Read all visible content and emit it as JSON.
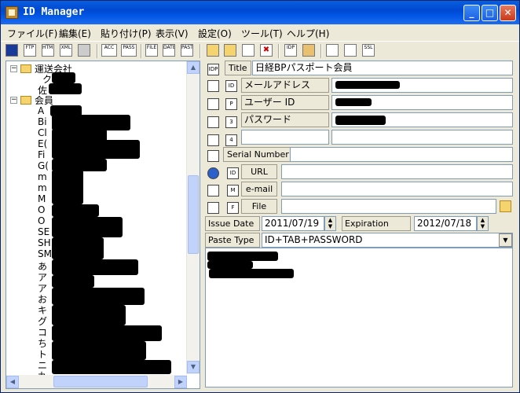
{
  "window": {
    "title": "ID Manager"
  },
  "menu": [
    "ファイル(F)",
    "編集(E)",
    "貼り付け(P)",
    "表示(V)",
    "設定(O)",
    "ツール(T)",
    "ヘルプ(H)"
  ],
  "toolbar": {
    "icons": [
      "save-icon",
      "ftp-icon",
      "html-icon",
      "xml-icon",
      "print-icon",
      "acc-icon",
      "pass-icon",
      "file-icon",
      "date-icon",
      "paste-icon",
      "new-folder-icon",
      "open-folder-icon",
      "new-item-icon",
      "delete-icon",
      "id-icon",
      "properties-icon",
      "lock-icon",
      "window-icon",
      "ssl-icon"
    ],
    "labels": {
      "ftp": "FTP",
      "html": "HTML",
      "xml": "XML",
      "acc": "ACC",
      "pass": "PASS",
      "file": "FILE",
      "date": "DATE",
      "paste": "PASTE",
      "id": "IDP",
      "ssl": "SSL"
    }
  },
  "tree": {
    "groups": [
      {
        "label": "運送会社",
        "expanded": true,
        "children": [
          "ク",
          "佐"
        ]
      },
      {
        "label": "会員",
        "expanded": true,
        "children": [
          "A",
          "Bi",
          "Cl",
          "E(",
          "Fi",
          "G(",
          "m",
          "m",
          "M",
          "O",
          "O",
          "SE",
          "SH",
          "SM",
          "あ",
          "ア",
          "ア",
          "お",
          "キ",
          "グ",
          "コ",
          "ち",
          "ト",
          "ニ",
          "丸"
        ]
      }
    ]
  },
  "fields": {
    "title_label": "Title",
    "title_value": "日経BPパスポート会員",
    "custom1_label": "メールアドレス",
    "custom2_label": "ユーザー ID",
    "custom3_label": "パスワード",
    "serial_label": "Serial Number",
    "url_label": "URL",
    "email_label": "e-mail",
    "file_label": "File",
    "issue_label": "Issue Date",
    "issue_value": "2011/07/19",
    "expiration_label": "Expiration Date",
    "expiration_value": "2012/07/18",
    "paste_type_label": "Paste Type",
    "paste_type_value": "ID+TAB+PASSWORD"
  }
}
